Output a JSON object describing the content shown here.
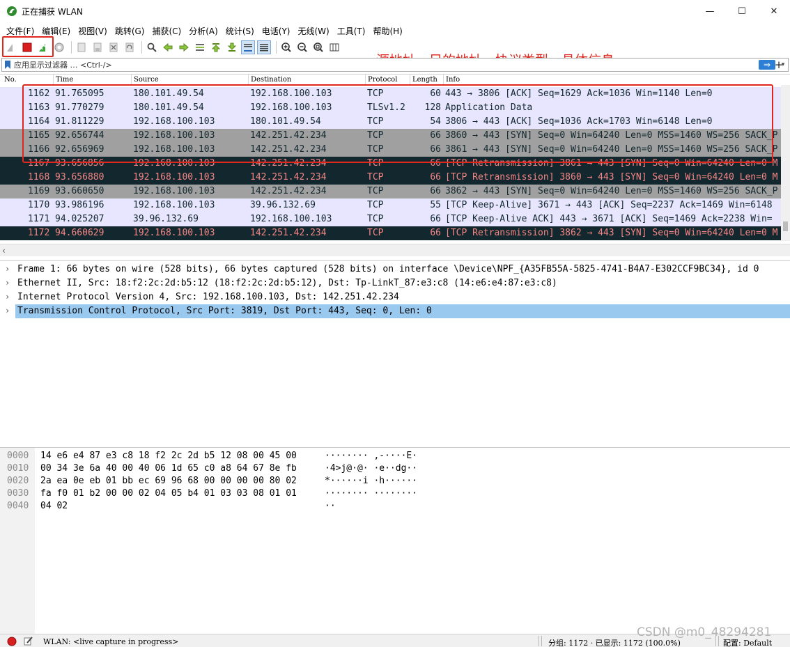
{
  "window": {
    "title": "正在捕获 WLAN",
    "minimize_glyph": "—",
    "maximize_glyph": "☐",
    "close_glyph": "✕"
  },
  "menu": [
    "文件(F)",
    "编辑(E)",
    "视图(V)",
    "跳转(G)",
    "捕获(C)",
    "分析(A)",
    "统计(S)",
    "电话(Y)",
    "无线(W)",
    "工具(T)",
    "帮助(H)"
  ],
  "toolbar": {
    "icons": [
      "shark-fin-start-icon",
      "stop-capture-icon",
      "restart-capture-icon",
      "capture-options-icon",
      "open-file-icon",
      "save-file-icon",
      "close-file-icon",
      "reload-icon",
      "find-packet-icon",
      "go-back-icon",
      "go-forward-icon",
      "go-to-packet-icon",
      "go-first-icon",
      "go-last-icon",
      "autoscroll-icon",
      "colorize-icon",
      "zoom-in-icon",
      "zoom-out-icon",
      "zoom-reset-icon",
      "resize-columns-icon"
    ],
    "colors": {
      "stop": "#d81e1e",
      "restart": "#3aa33a",
      "annotation": "#e0271e"
    }
  },
  "annotation": "源地址，目的地址，协议类型，具体信息",
  "filter": {
    "placeholder": "应用显示过滤器 … <Ctrl-/>",
    "apply_glyph": "⇒",
    "dropdown_glyph": "▾",
    "add_glyph": "+"
  },
  "packet_list": {
    "columns": [
      "No.",
      "Time",
      "Source",
      "Destination",
      "Protocol",
      "Length",
      "Info"
    ],
    "rows": [
      {
        "no": "1162",
        "time": "91.765095",
        "src": "180.101.49.54",
        "dst": "192.168.100.103",
        "proto": "TCP",
        "len": "60",
        "info": "443 → 3806 [ACK] Seq=1629 Ack=1036 Win=1140 Len=0",
        "style": "light"
      },
      {
        "no": "1163",
        "time": "91.770279",
        "src": "180.101.49.54",
        "dst": "192.168.100.103",
        "proto": "TLSv1.2",
        "len": "128",
        "info": "Application Data",
        "style": "light"
      },
      {
        "no": "1164",
        "time": "91.811229",
        "src": "192.168.100.103",
        "dst": "180.101.49.54",
        "proto": "TCP",
        "len": "54",
        "info": "3806 → 443 [ACK] Seq=1036 Ack=1703 Win=6148 Len=0",
        "style": "light"
      },
      {
        "no": "1165",
        "time": "92.656744",
        "src": "192.168.100.103",
        "dst": "142.251.42.234",
        "proto": "TCP",
        "len": "66",
        "info": "3860 → 443 [SYN] Seq=0 Win=64240 Len=0 MSS=1460 WS=256 SACK_P",
        "style": "gray"
      },
      {
        "no": "1166",
        "time": "92.656969",
        "src": "192.168.100.103",
        "dst": "142.251.42.234",
        "proto": "TCP",
        "len": "66",
        "info": "3861 → 443 [SYN] Seq=0 Win=64240 Len=0 MSS=1460 WS=256 SACK_P",
        "style": "gray"
      },
      {
        "no": "1167",
        "time": "93.656856",
        "src": "192.168.100.103",
        "dst": "142.251.42.234",
        "proto": "TCP",
        "len": "66",
        "info": "[TCP Retransmission] 3861 → 443 [SYN] Seq=0 Win=64240 Len=0 M",
        "style": "dark"
      },
      {
        "no": "1168",
        "time": "93.656880",
        "src": "192.168.100.103",
        "dst": "142.251.42.234",
        "proto": "TCP",
        "len": "66",
        "info": "[TCP Retransmission] 3860 → 443 [SYN] Seq=0 Win=64240 Len=0 M",
        "style": "dark"
      },
      {
        "no": "1169",
        "time": "93.660650",
        "src": "192.168.100.103",
        "dst": "142.251.42.234",
        "proto": "TCP",
        "len": "66",
        "info": "3862 → 443 [SYN] Seq=0 Win=64240 Len=0 MSS=1460 WS=256 SACK_P",
        "style": "gray"
      },
      {
        "no": "1170",
        "time": "93.986196",
        "src": "192.168.100.103",
        "dst": "39.96.132.69",
        "proto": "TCP",
        "len": "55",
        "info": "[TCP Keep-Alive] 3671 → 443 [ACK] Seq=2237 Ack=1469 Win=6148",
        "style": "light"
      },
      {
        "no": "1171",
        "time": "94.025207",
        "src": "39.96.132.69",
        "dst": "192.168.100.103",
        "proto": "TCP",
        "len": "66",
        "info": "[TCP Keep-Alive ACK] 443 → 3671 [ACK] Seq=1469 Ack=2238 Win=",
        "style": "light"
      },
      {
        "no": "1172",
        "time": "94.660629",
        "src": "192.168.100.103",
        "dst": "142.251.42.234",
        "proto": "TCP",
        "len": "66",
        "info": "[TCP Retransmission] 3862 → 443 [SYN] Seq=0 Win=64240 Len=0 M",
        "style": "dark"
      }
    ],
    "row_colors": {
      "light": {
        "bg": "#e7e6fe",
        "fg": "#12272e"
      },
      "gray": {
        "bg": "#a0a0a0",
        "fg": "#12272e"
      },
      "dark": {
        "bg": "#12272e",
        "fg": "#f78787"
      }
    }
  },
  "details": [
    {
      "text": "Frame 1: 66 bytes on wire (528 bits), 66 bytes captured (528 bits) on interface \\Device\\NPF_{A35FB55A-5825-4741-B4A7-E302CCF9BC34}, id 0",
      "selected": false
    },
    {
      "text": "Ethernet II, Src: 18:f2:2c:2d:b5:12 (18:f2:2c:2d:b5:12), Dst: Tp-LinkT_87:e3:c8 (14:e6:e4:87:e3:c8)",
      "selected": false
    },
    {
      "text": "Internet Protocol Version 4, Src: 192.168.100.103, Dst: 142.251.42.234",
      "selected": false
    },
    {
      "text": "Transmission Control Protocol, Src Port: 3819, Dst Port: 443, Seq: 0, Len: 0",
      "selected": true
    }
  ],
  "bytes": [
    {
      "offset": "0000",
      "hex": "14 e6 e4 87 e3 c8 18 f2  2c 2d b5 12 08 00 45 00",
      "ascii": "········ ,-····E·"
    },
    {
      "offset": "0010",
      "hex": "00 34 3e 6a 40 00 40 06  1d 65 c0 a8 64 67 8e fb",
      "ascii": "·4>j@·@· ·e··dg··"
    },
    {
      "offset": "0020",
      "hex": "2a ea 0e eb 01 bb ec 69  96 68 00 00 00 00 80 02",
      "ascii": "*······i ·h······"
    },
    {
      "offset": "0030",
      "hex": "fa f0 01 b2 00 00 02 04  05 b4 01 03 03 08 01 01",
      "ascii": "········ ········"
    },
    {
      "offset": "0040",
      "hex": "04 02",
      "ascii": "··"
    }
  ],
  "status": {
    "interface": "WLAN: <live capture in progress>",
    "packets": "分组: 1172 · 已显示: 1172 (100.0%)",
    "profile": "配置: Default"
  },
  "watermark": "CSDN @m0_48294281"
}
